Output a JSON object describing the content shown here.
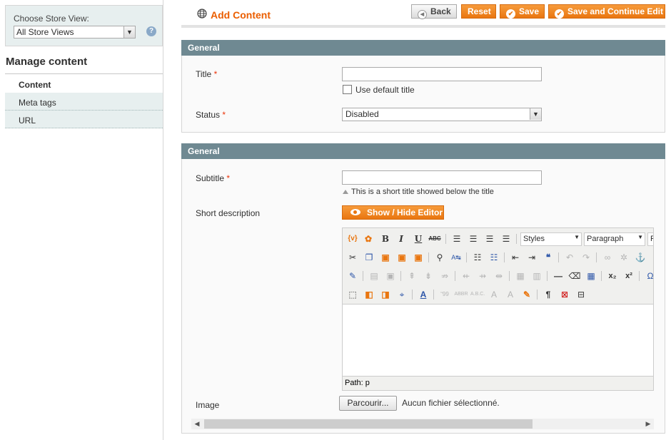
{
  "sidebar": {
    "store_view_label": "Choose Store View:",
    "store_view_value": "All Store Views",
    "manage_title": "Manage content",
    "tabs": [
      {
        "label": "Content"
      },
      {
        "label": "Meta tags"
      },
      {
        "label": "URL"
      }
    ]
  },
  "header": {
    "title": "Add Content",
    "buttons": {
      "back": "Back",
      "reset": "Reset",
      "save": "Save",
      "save_continue": "Save and Continue Edit"
    }
  },
  "section1": {
    "heading": "General",
    "title_label": "Title",
    "required_mark": "*",
    "title_value": "",
    "use_default_label": "Use default title",
    "status_label": "Status",
    "status_value": "Disabled"
  },
  "section2": {
    "heading": "General",
    "subtitle_label": "Subtitle",
    "subtitle_value": "",
    "subtitle_note": "This is a short title showed below the title",
    "short_desc_label": "Short description",
    "editor_button": "Show / Hide Editor",
    "editor": {
      "styles_select": "Styles",
      "format_select": "Paragraph",
      "font_select": "F",
      "path": "Path: p"
    },
    "image_label": "Image",
    "file_button": "Parcourir...",
    "file_status": "Aucun fichier sélectionné."
  },
  "colors": {
    "accent": "#eb5e00",
    "button_orange": "#e97610",
    "section_header": "#6f8992",
    "sidebar_bg": "#e7efef"
  }
}
